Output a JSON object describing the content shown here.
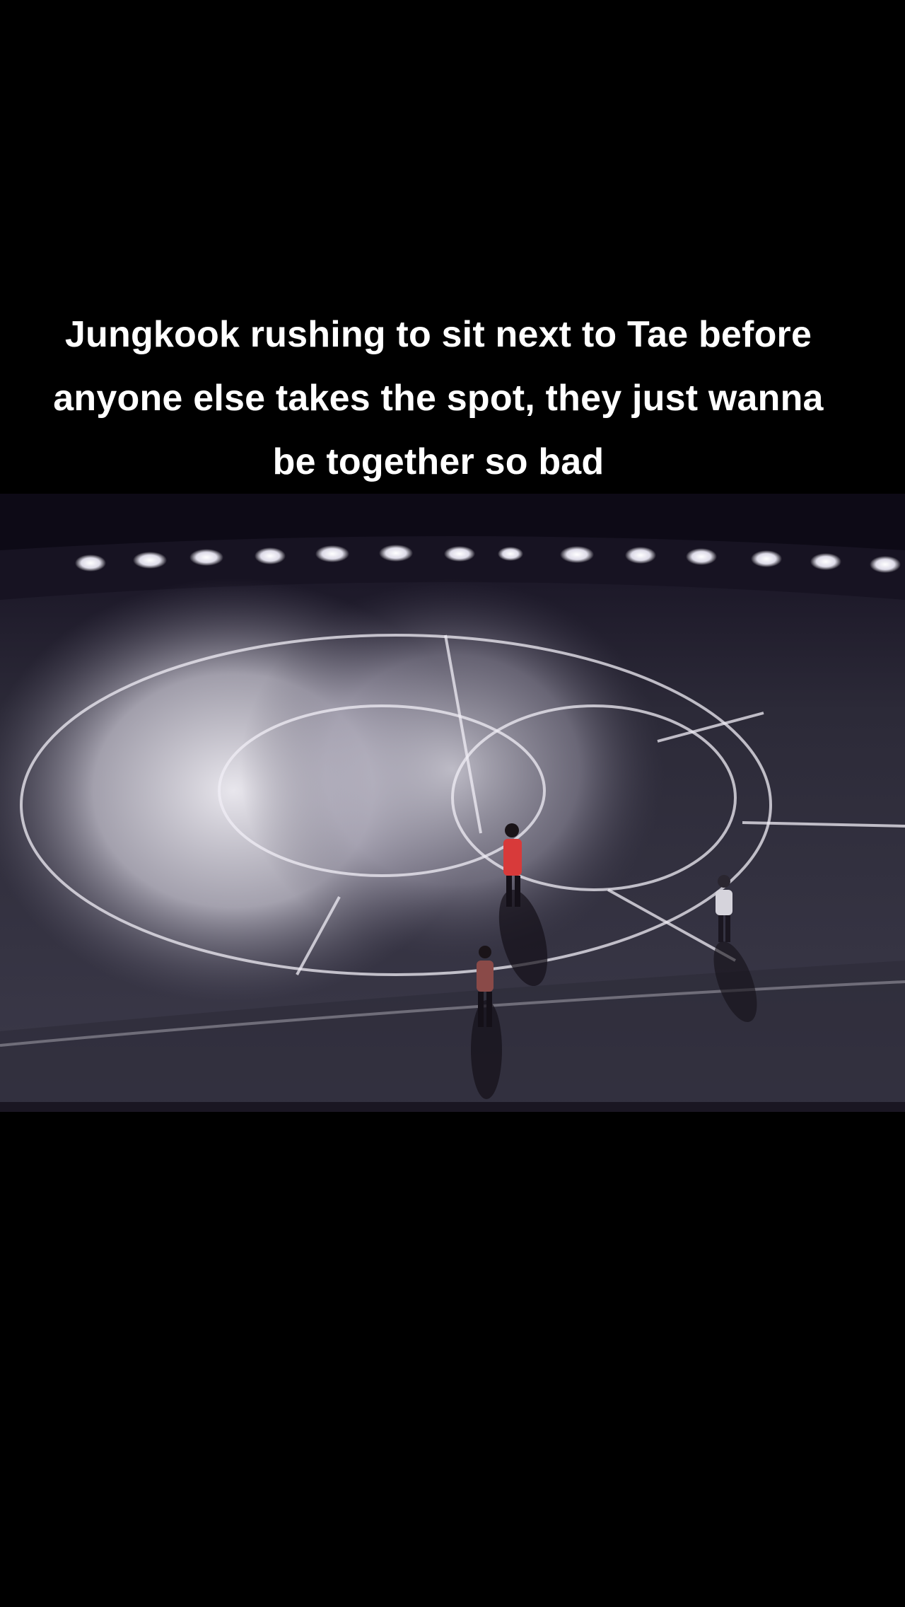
{
  "caption": {
    "text": "Jungkook rushing to sit next to Tae before anyone else takes the spot, they just wanna be together so bad"
  },
  "video": {
    "description_icon": "video-frame",
    "colors": {
      "background": "#000000",
      "sky": "#120e1c",
      "floor": "#3a3848",
      "spotlight": "#e8e6ee",
      "jersey": "#d83a3a",
      "lines": "#ffffff"
    }
  }
}
